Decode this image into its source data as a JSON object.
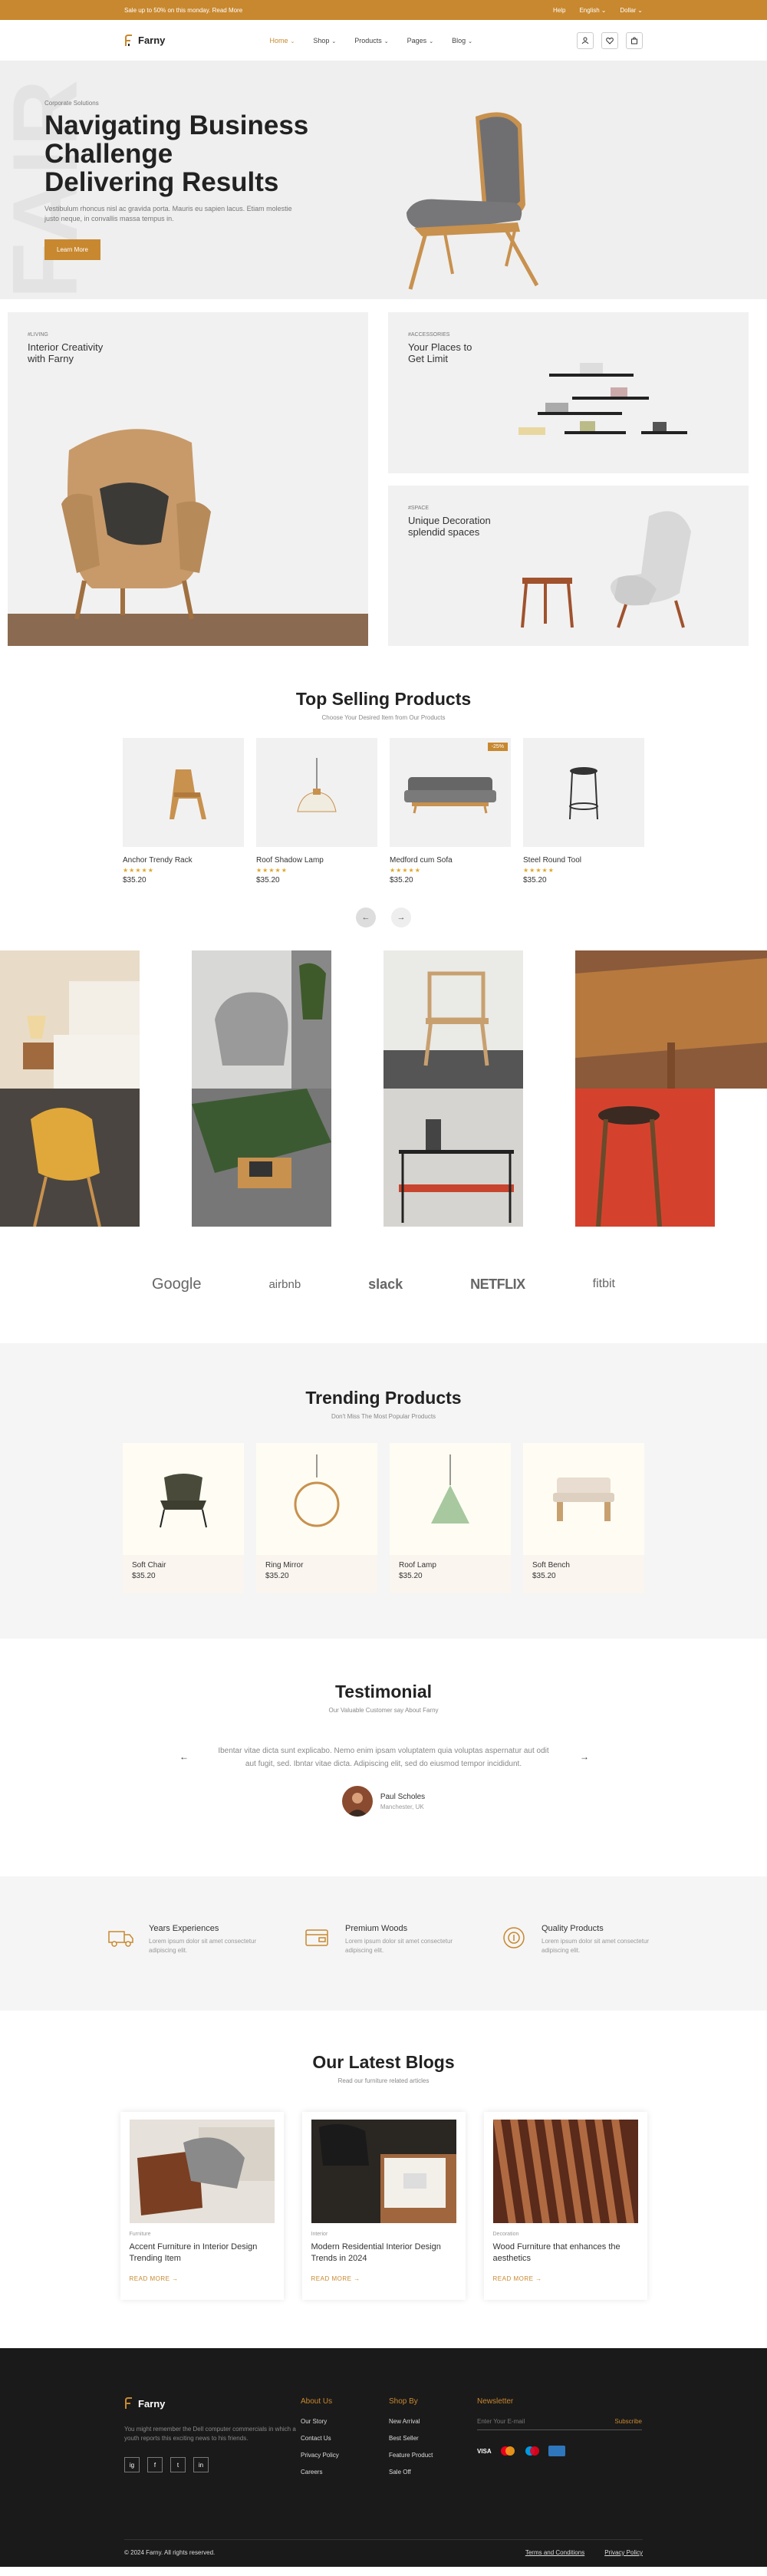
{
  "topbar": {
    "promo": "Sale up to 50% on this monday. Read More",
    "help": "Help",
    "language": "English",
    "currency": "Dollar"
  },
  "header": {
    "brand": "Farny",
    "nav": [
      "Home",
      "Shop",
      "Products",
      "Pages",
      "Blog"
    ]
  },
  "hero": {
    "watermark": "FAIR",
    "subtitle": "Corporate Solutions",
    "title_lines": [
      "Navigating Business",
      "Challenge",
      "Delivering Results"
    ],
    "text": "Vestibulum rhoncus nisl ac gravida porta. Mauris eu sapien lacus. Etiam molestie justo neque, in convallis massa tempus in.",
    "button": "Learn More"
  },
  "categories": [
    {
      "tag": "#LIVING",
      "title1": "Interior Creativity",
      "title2": "with Farny"
    },
    {
      "tag": "#ACCESSORIES",
      "title1": "Your Places to",
      "title2": "Get Limit"
    },
    {
      "tag": "#SPACE",
      "title1": "Unique Decoration",
      "title2": "splendid spaces"
    }
  ],
  "top_selling": {
    "title": "Top Selling Products",
    "subtitle": "Choose Your Desired Item from Our Products",
    "products": [
      {
        "name": "Anchor Trendy Rack",
        "price": "$35.20",
        "rating": "5"
      },
      {
        "name": "Roof Shadow Lamp",
        "price": "$35.20",
        "rating": "5"
      },
      {
        "name": "Medford cum Sofa",
        "price": "$35.20",
        "rating": "5",
        "badge": "-25%"
      },
      {
        "name": "Steel Round Tool",
        "price": "$35.20",
        "rating": "5"
      }
    ],
    "prev": "←",
    "next": "→"
  },
  "brands": [
    "Google",
    "airbnb",
    "slack",
    "NETFLIX",
    "fitbit"
  ],
  "trending": {
    "title": "Trending Products",
    "subtitle": "Don't Miss The Most Popular Products",
    "products": [
      {
        "name": "Soft Chair",
        "price": "$35.20"
      },
      {
        "name": "Ring Mirror",
        "price": "$35.20"
      },
      {
        "name": "Roof Lamp",
        "price": "$35.20"
      },
      {
        "name": "Soft Bench",
        "price": "$35.20"
      }
    ]
  },
  "testimonial": {
    "title": "Testimonial",
    "subtitle": "Our Valuable Customer say About Farny",
    "quote": "Ibentar vitae dicta sunt explicabo. Nemo enim ipsam voluptatem quia voluptas aspernatur aut odit aut fugit, sed. Ibntar vitae dicta. Adipiscing elit, sed do eiusmod tempor incididunt.",
    "name": "Paul Scholes",
    "location": "Manchester, UK",
    "prev": "←",
    "next": "→"
  },
  "features": [
    {
      "title": "Years Experiences",
      "desc": "Lorem ipsum dolor sit amet consectetur adipiscing elit."
    },
    {
      "title": "Premium Woods",
      "desc": "Lorem ipsum dolor sit amet consectetur adipiscing elit."
    },
    {
      "title": "Quality Products",
      "desc": "Lorem ipsum dolor sit amet consectetur adipiscing elit."
    }
  ],
  "blogs": {
    "title": "Our Latest Blogs",
    "subtitle": "Read our furniture related articles",
    "items": [
      {
        "cat": "Furniture",
        "title": "Accent Furniture in Interior Design Trending Item",
        "more": "READ MORE →"
      },
      {
        "cat": "Interior",
        "title": "Modern Residential Interior Design Trends in 2024",
        "more": "READ MORE →"
      },
      {
        "cat": "Decoration",
        "title": "Wood Furniture that enhances the aesthetics",
        "more": "READ MORE →"
      }
    ]
  },
  "footer": {
    "brand": "Farny",
    "text": "You might remember the Dell computer commercials in which a youth reports this exciting news to his friends.",
    "about_head": "About Us",
    "about": [
      "Our Story",
      "Contact Us",
      "Privacy Policy",
      "Careers"
    ],
    "shop_head": "Shop By",
    "shop": [
      "New Arrival",
      "Best Seller",
      "Feature Product",
      "Sale Off"
    ],
    "news_head": "Newsletter",
    "email_placeholder": "Enter Your E-mail",
    "subscribe": "Subscribe",
    "pay": [
      "VISA"
    ],
    "socials": [
      "ig",
      "f",
      "t",
      "in"
    ],
    "copyright": "© 2024 Farny. All rights reserved.",
    "terms": "Terms and Conditions",
    "privacy": "Privacy Policy"
  },
  "colors": {
    "accent": "#c8882f",
    "dark": "#1a1a1a",
    "light_bg": "#f1f1f1"
  }
}
